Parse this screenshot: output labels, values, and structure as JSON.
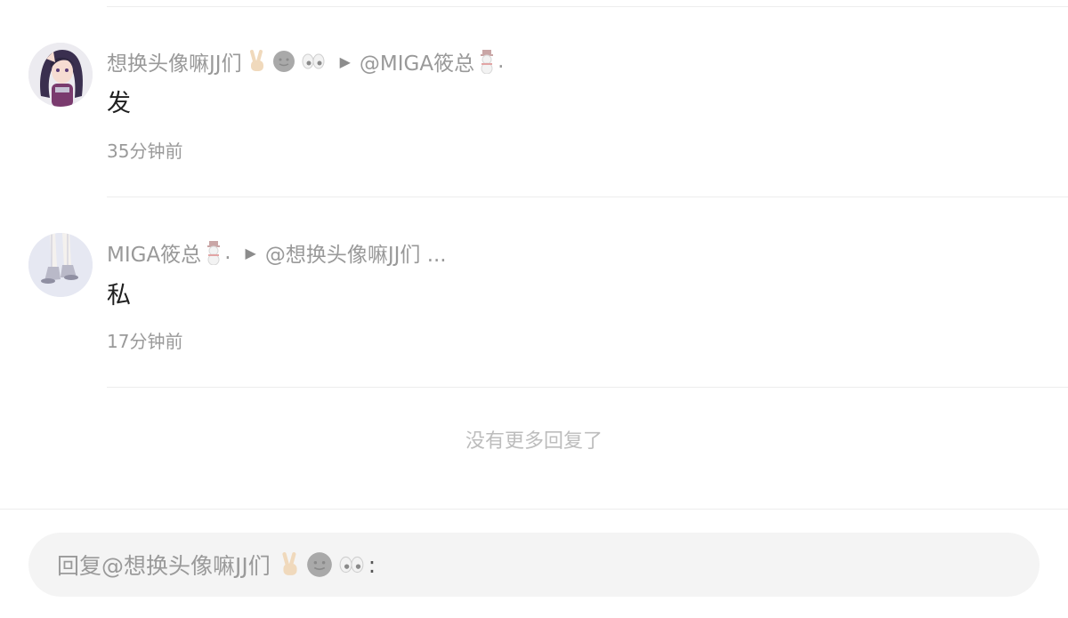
{
  "comments": [
    {
      "author": "想换头像嘛JJ们",
      "author_emojis": [
        "victory-hand-icon",
        "grey-face-icon",
        "eyes-icon"
      ],
      "reply_to": "@MIGA筱总",
      "reply_to_suffix": ".",
      "reply_to_emoji": "snowman-icon",
      "content": "发",
      "time": "35分钟前"
    },
    {
      "author": "MIGA筱总",
      "author_suffix": ".",
      "author_emoji": "snowman-icon",
      "reply_to": "@想换头像嘛JJ们 ...",
      "content": "私",
      "time": "17分钟前"
    }
  ],
  "arrow_glyph": "▶",
  "no_more_text": "没有更多回复了",
  "reply_input": {
    "prefix": "回复@想换头像嘛JJ们",
    "emojis": [
      "victory-hand-icon",
      "grey-face-icon",
      "eyes-icon"
    ],
    "suffix": ":"
  },
  "colors": {
    "text_primary": "#1f1f1f",
    "text_secondary": "#999999",
    "no_more": "#bdbdbd",
    "input_background": "#f4f4f4"
  }
}
